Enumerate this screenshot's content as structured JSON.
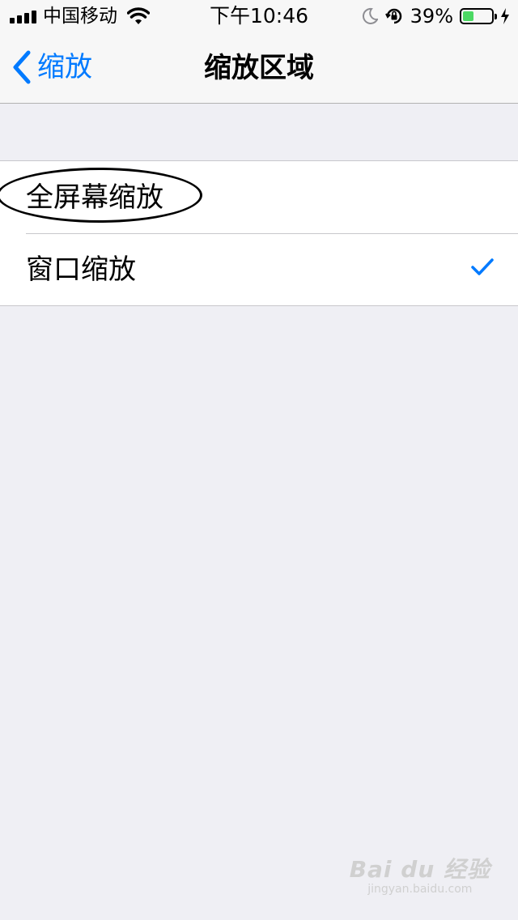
{
  "status_bar": {
    "carrier": "中国移动",
    "time": "下午10:46",
    "battery_percent": "39%",
    "battery_level": 0.39,
    "icons": [
      "signal-icon",
      "wifi-icon",
      "moon-icon",
      "orientation-lock-icon",
      "battery-icon",
      "charging-icon"
    ]
  },
  "nav": {
    "back_label": "缩放",
    "title": "缩放区域"
  },
  "options": [
    {
      "label": "全屏幕缩放",
      "selected": false,
      "annotated": true
    },
    {
      "label": "窗口缩放",
      "selected": true,
      "annotated": false
    }
  ],
  "colors": {
    "accent": "#007aff",
    "battery": "#4cd964",
    "background": "#efeff4"
  },
  "watermark": {
    "main": "Bai du 经验",
    "sub": "jingyan.baidu.com"
  }
}
